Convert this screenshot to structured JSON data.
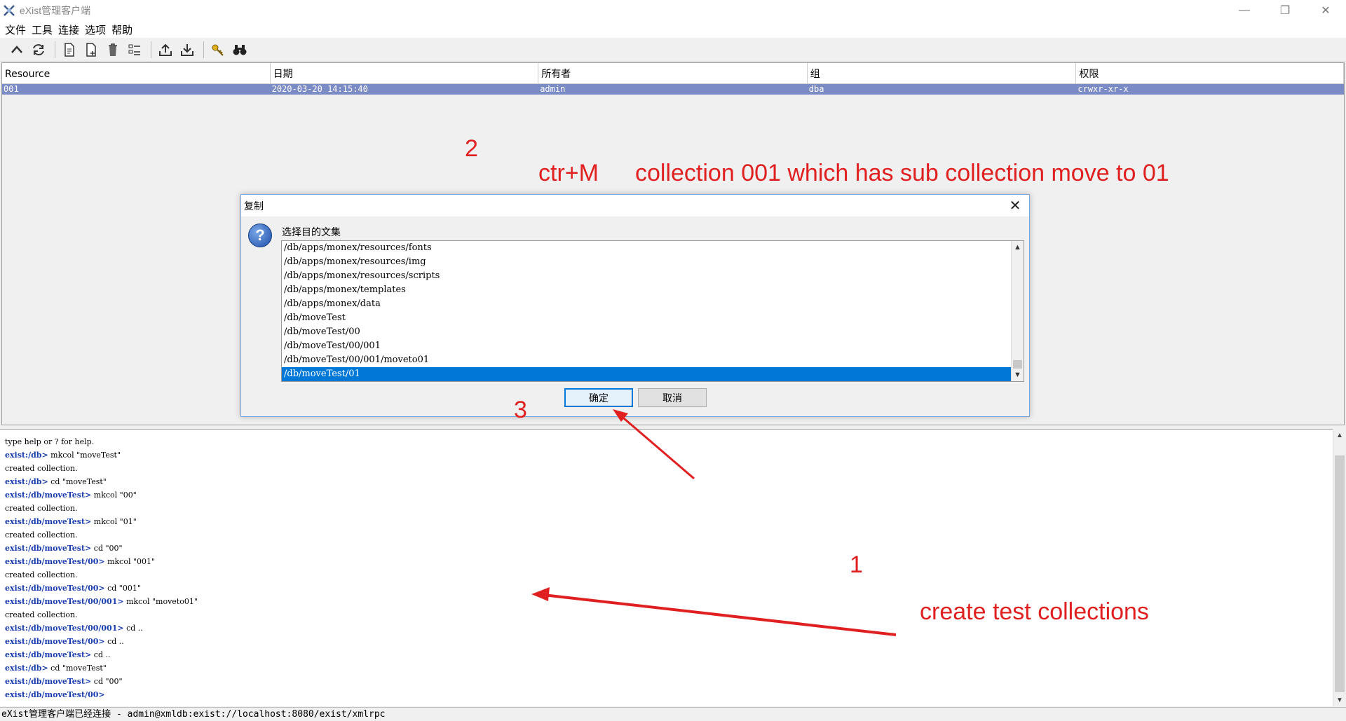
{
  "window": {
    "title": "eXist管理客户端",
    "minimize": "—",
    "restore": "❐",
    "close": "✕"
  },
  "menu": [
    "文件",
    "工具",
    "连接",
    "选项",
    "帮助"
  ],
  "table": {
    "headers": [
      "Resource",
      "日期",
      "所有者",
      "组",
      "权限"
    ],
    "selected_row": [
      "001",
      "2020-03-20 14:15:40",
      "admin",
      "dba",
      "crwxr-xr-x"
    ]
  },
  "annotations": {
    "step2": "2",
    "shortcut": "ctr+M",
    "step2_note": "collection 001 which has sub collection move to 01",
    "step3": "3",
    "step1": "1",
    "step1_note": "create test collections",
    "color": "#e02020"
  },
  "dialog": {
    "title": "复制",
    "label": "选择目的文集",
    "items": [
      "/db/apps/monex/resources/fonts",
      "/db/apps/monex/resources/img",
      "/db/apps/monex/resources/scripts",
      "/db/apps/monex/templates",
      "/db/apps/monex/data",
      "/db/moveTest",
      "/db/moveTest/00",
      "/db/moveTest/00/001",
      "/db/moveTest/00/001/moveto01",
      "/db/moveTest/01"
    ],
    "selected_index": 9,
    "ok": "确定",
    "cancel": "取消"
  },
  "console": [
    {
      "prompt": "",
      "text": "type help or ? for help."
    },
    {
      "prompt": "exist:/db>",
      "text": " mkcol \"moveTest\""
    },
    {
      "prompt": "",
      "text": "created collection."
    },
    {
      "prompt": "exist:/db>",
      "text": " cd \"moveTest\""
    },
    {
      "prompt": "exist:/db/moveTest>",
      "text": " mkcol \"00\""
    },
    {
      "prompt": "",
      "text": "created collection."
    },
    {
      "prompt": "exist:/db/moveTest>",
      "text": " mkcol \"01\""
    },
    {
      "prompt": "",
      "text": "created collection."
    },
    {
      "prompt": "exist:/db/moveTest>",
      "text": " cd \"00\""
    },
    {
      "prompt": "exist:/db/moveTest/00>",
      "text": " mkcol \"001\""
    },
    {
      "prompt": "",
      "text": "created collection."
    },
    {
      "prompt": "exist:/db/moveTest/00>",
      "text": " cd \"001\""
    },
    {
      "prompt": "exist:/db/moveTest/00/001>",
      "text": " mkcol \"moveto01\""
    },
    {
      "prompt": "",
      "text": "created collection."
    },
    {
      "prompt": "exist:/db/moveTest/00/001>",
      "text": " cd .."
    },
    {
      "prompt": "exist:/db/moveTest/00>",
      "text": " cd .."
    },
    {
      "prompt": "exist:/db/moveTest>",
      "text": " cd .."
    },
    {
      "prompt": "exist:/db>",
      "text": " cd \"moveTest\""
    },
    {
      "prompt": "exist:/db/moveTest>",
      "text": " cd \"00\""
    },
    {
      "prompt": "exist:/db/moveTest/00>",
      "text": ""
    }
  ],
  "status": "eXist管理客户端已经连接 - admin@xmldb:exist://localhost:8080/exist/xmlrpc",
  "toolbar_icons": [
    "up-icon",
    "refresh-icon",
    "new-collection-icon",
    "new-document-icon",
    "delete-icon",
    "properties-icon",
    "upload-icon",
    "download-icon",
    "key-icon",
    "binoculars-icon"
  ]
}
